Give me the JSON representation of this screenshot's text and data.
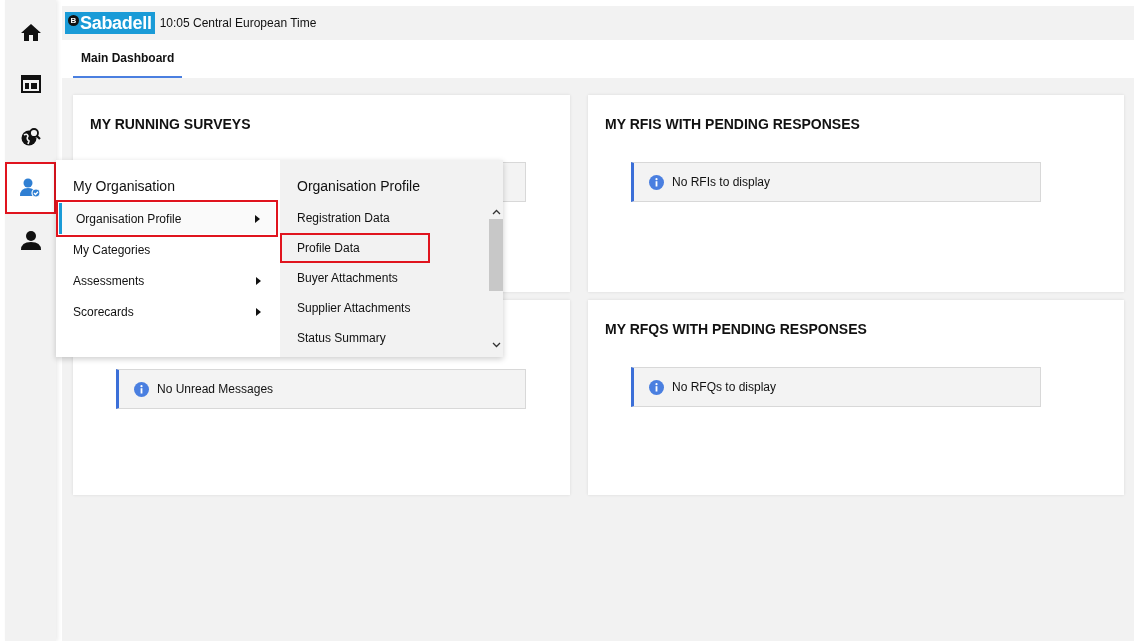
{
  "sidebar": {
    "items": [
      {
        "kind": "home",
        "selected": false,
        "highlighted": false
      },
      {
        "kind": "layout",
        "selected": false,
        "highlighted": false
      },
      {
        "kind": "globe",
        "selected": false,
        "highlighted": false
      },
      {
        "kind": "organisation",
        "selected": true,
        "highlighted": true
      },
      {
        "kind": "profile",
        "selected": false,
        "highlighted": false
      }
    ]
  },
  "header": {
    "logo": {
      "badge": "B",
      "text": "Sabadell"
    },
    "time": "10:05 Central European Time"
  },
  "tabs": [
    {
      "label": "Main Dashboard",
      "selected": true
    }
  ],
  "cards": [
    {
      "title": "MY RUNNING SURVEYS",
      "notice": {
        "kind": "info"
      }
    },
    {
      "title": "MY RFIS WITH PENDING RESPONSES",
      "notice": {
        "kind": "info",
        "text": "No RFIs to display"
      }
    },
    {
      "notice": {
        "kind": "info",
        "text": "No Unread Messages"
      }
    },
    {
      "title": "MY RFQS WITH PENDING RESPONSES",
      "notice": {
        "kind": "info",
        "text": "No RFQs to display"
      }
    }
  ],
  "menu": {
    "title": "My Organisation",
    "items": [
      {
        "label": "Organisation Profile",
        "has_submenu": true,
        "selected": true,
        "highlighted": true
      },
      {
        "label": "My Categories",
        "has_submenu": false,
        "selected": false,
        "highlighted": false
      },
      {
        "label": "Assessments",
        "has_submenu": true,
        "selected": false,
        "highlighted": false
      },
      {
        "label": "Scorecards",
        "has_submenu": true,
        "selected": false,
        "highlighted": false
      }
    ],
    "submenu": {
      "title": "Organisation Profile",
      "items": [
        {
          "label": "Registration Data",
          "highlighted": false
        },
        {
          "label": "Profile Data",
          "highlighted": true
        },
        {
          "label": "Buyer Attachments",
          "highlighted": false
        },
        {
          "label": "Supplier Attachments",
          "highlighted": false
        },
        {
          "label": "Status Summary",
          "highlighted": false
        }
      ]
    }
  }
}
